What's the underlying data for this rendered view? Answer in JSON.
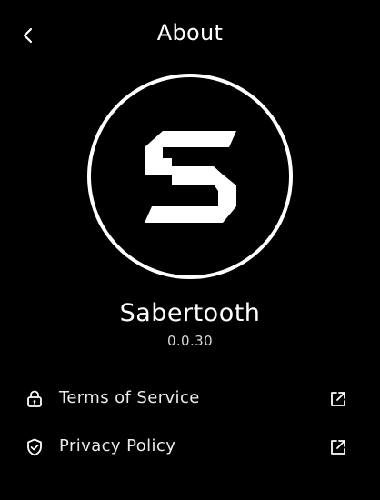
{
  "header": {
    "title": "About",
    "back_icon": "chevron-left-icon"
  },
  "app": {
    "logo_icon": "sabertooth-logo",
    "name": "Sabertooth",
    "version": "0.0.30"
  },
  "links": [
    {
      "label": "Terms of Service",
      "icon": "lock-icon",
      "trailing_icon": "external-link-icon"
    },
    {
      "label": "Privacy Policy",
      "icon": "shield-check-icon",
      "trailing_icon": "external-link-icon"
    }
  ],
  "colors": {
    "background": "#000000",
    "foreground": "#ffffff"
  }
}
